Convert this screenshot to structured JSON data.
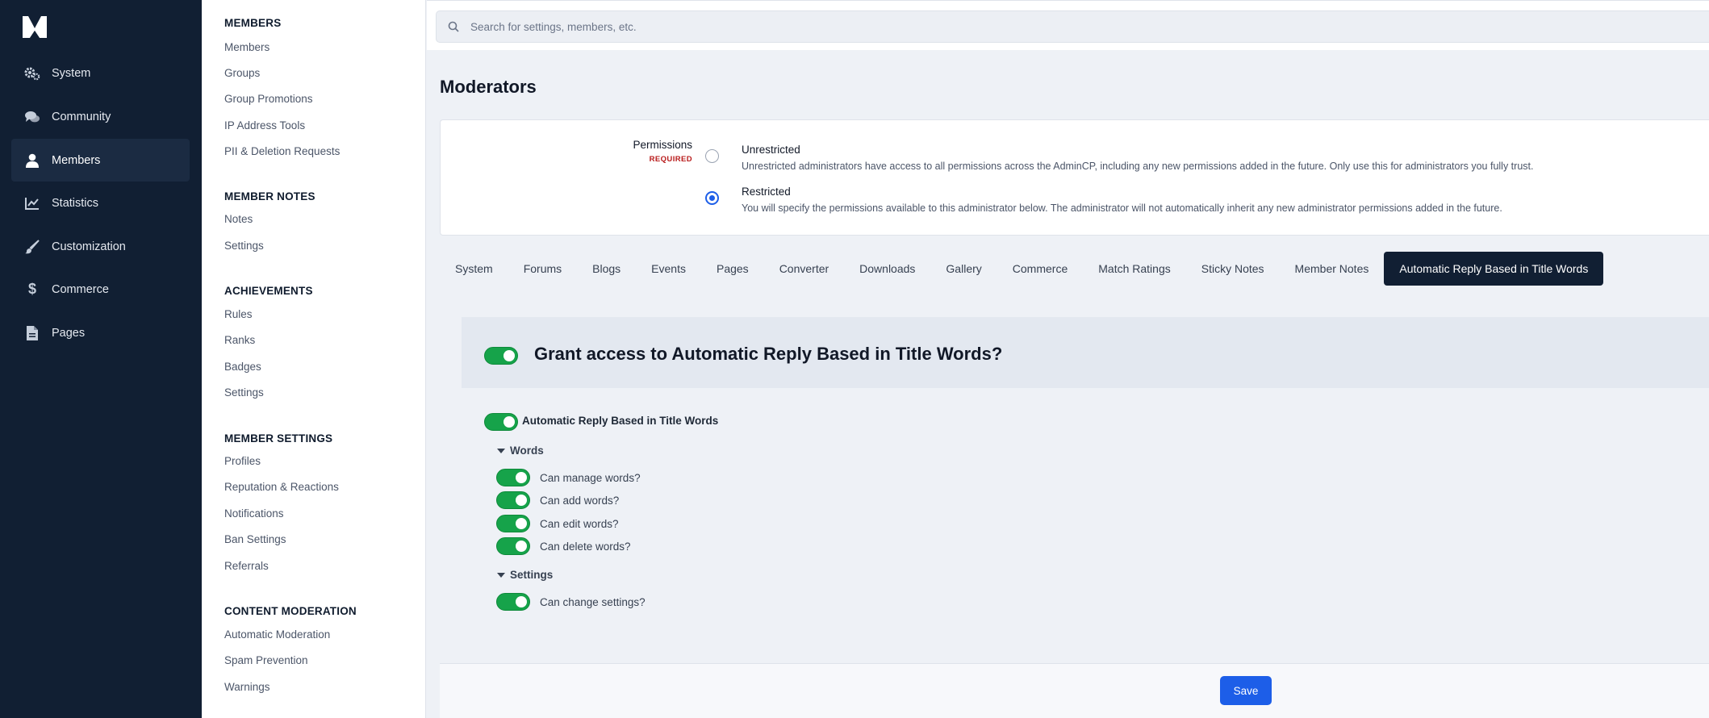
{
  "nav": {
    "items": [
      {
        "label": "System",
        "icon": "gears-icon"
      },
      {
        "label": "Community",
        "icon": "chat-bubbles-icon"
      },
      {
        "label": "Members",
        "icon": "user-icon",
        "active": true
      },
      {
        "label": "Statistics",
        "icon": "line-chart-icon"
      },
      {
        "label": "Customization",
        "icon": "paintbrush-icon"
      },
      {
        "label": "Commerce",
        "icon": "dollar-icon"
      },
      {
        "label": "Pages",
        "icon": "document-icon"
      }
    ]
  },
  "submenu": {
    "sections": [
      {
        "heading": "MEMBERS",
        "links": [
          "Members",
          "Groups",
          "Group Promotions",
          "IP Address Tools",
          "PII & Deletion Requests"
        ]
      },
      {
        "heading": "MEMBER NOTES",
        "links": [
          "Notes",
          "Settings"
        ]
      },
      {
        "heading": "ACHIEVEMENTS",
        "links": [
          "Rules",
          "Ranks",
          "Badges",
          "Settings"
        ]
      },
      {
        "heading": "MEMBER SETTINGS",
        "links": [
          "Profiles",
          "Reputation & Reactions",
          "Notifications",
          "Ban Settings",
          "Referrals"
        ]
      },
      {
        "heading": "CONTENT MODERATION",
        "links": [
          "Automatic Moderation",
          "Spam Prevention",
          "Warnings"
        ]
      }
    ]
  },
  "search": {
    "placeholder": "Search for settings, members, etc."
  },
  "page": {
    "title": "Moderators"
  },
  "permissions": {
    "label": "Permissions",
    "required": "REQUIRED",
    "options": [
      {
        "title": "Unrestricted",
        "desc": "Unrestricted administrators have access to all permissions across the AdminCP, including any new permissions added in the future. Only use this for administrators you fully trust.",
        "checked": false
      },
      {
        "title": "Restricted",
        "desc": "You will specify the permissions available to this administrator below. The administrator will not automatically inherit any new administrator permissions added in the future.",
        "checked": true
      }
    ]
  },
  "tabs": [
    "System",
    "Forums",
    "Blogs",
    "Events",
    "Pages",
    "Converter",
    "Downloads",
    "Gallery",
    "Commerce",
    "Match Ratings",
    "Sticky Notes",
    "Member Notes",
    "Automatic Reply Based in Title Words"
  ],
  "active_tab": "Automatic Reply Based in Title Words",
  "grant": {
    "title": "Grant access to Automatic Reply Based in Title Words?"
  },
  "app_permission": {
    "label": "Automatic Reply Based in Title Words"
  },
  "groups": [
    {
      "heading": "Words",
      "items": [
        "Can manage words?",
        "Can add words?",
        "Can edit words?",
        "Can delete words?"
      ]
    },
    {
      "heading": "Settings",
      "items": [
        "Can change settings?"
      ]
    }
  ],
  "footer": {
    "save_label": "Save"
  },
  "colors": {
    "nav_bg": "#111f33",
    "accent": "#1d5ee8",
    "toggle_on": "#16a34a",
    "required": "#b91c1c"
  }
}
